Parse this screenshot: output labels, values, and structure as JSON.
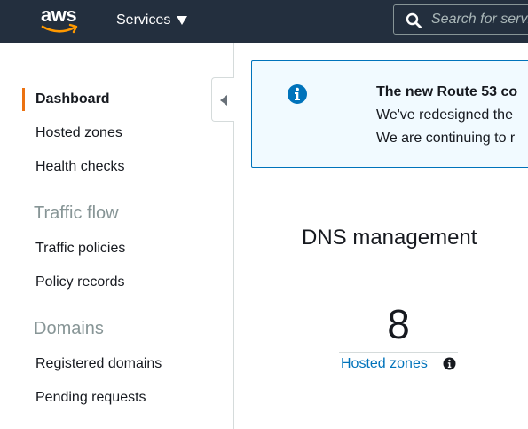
{
  "header": {
    "logo_text": "aws",
    "logo_icon": "aws-smile-icon",
    "services_label": "Services",
    "services_icon": "caret-down-icon",
    "search_placeholder": "Search for services",
    "search_icon": "search-icon",
    "colors": {
      "bar": "#232f3e",
      "accent": "#ff9900"
    }
  },
  "sidebar": {
    "items": [
      {
        "label": "Dashboard",
        "active": true
      },
      {
        "label": "Hosted zones"
      },
      {
        "label": "Health checks"
      }
    ],
    "sections": [
      {
        "title": "Traffic flow",
        "items": [
          {
            "label": "Traffic policies"
          },
          {
            "label": "Policy records"
          }
        ]
      },
      {
        "title": "Domains",
        "items": [
          {
            "label": "Registered domains"
          },
          {
            "label": "Pending requests"
          }
        ]
      }
    ],
    "collapse_icon": "chevron-left-icon",
    "active_color": "#ec7211"
  },
  "banner": {
    "icon": "info-circle-icon",
    "title": "The new Route 53 co",
    "lines": [
      "We've redesigned the",
      "We are continuing to r"
    ],
    "colors": {
      "background": "#f1faff",
      "border": "#0073bb"
    }
  },
  "dns": {
    "title": "DNS management",
    "stat": {
      "value": "8",
      "label": "Hosted zones",
      "info_icon": "info-circle-icon"
    },
    "link_color": "#0073bb"
  }
}
